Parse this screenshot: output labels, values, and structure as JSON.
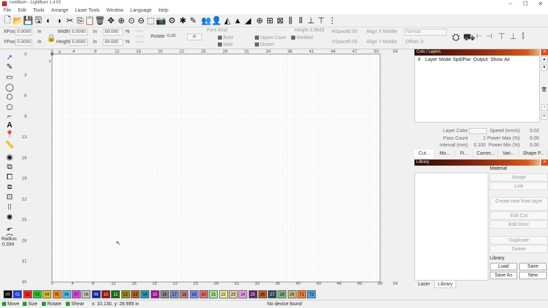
{
  "window": {
    "title": "<untitled> - LightBurn 1.4.03"
  },
  "menu": [
    "File",
    "Edit",
    "Tools",
    "Arrange",
    "Laser Tools",
    "Window",
    "Language",
    "Help"
  ],
  "props": {
    "xpos_label": "XPos",
    "xpos_value": "0.0000",
    "ypos_label": "YPos",
    "ypos_value": "0.0000",
    "unit_in": "in",
    "width_label": "Width",
    "width_value": "0.0000",
    "height_label": "Height",
    "height_value": "0.0000",
    "scale_w": "00.000",
    "scale_h": "00.000",
    "pct": "%",
    "rotate_label": "Rotate",
    "rotate_value": "0.00",
    "rotate_unit": "in",
    "font_label": "Font",
    "font_value": "Arial",
    "text_height_label": "Height",
    "text_height_value": "3.9843",
    "bold": "Bold",
    "italic": "Italic",
    "upper": "Upper Case",
    "welded": "Welded",
    "distort": "Distort",
    "hspace_label": "HSpace",
    "hspace_value": "0.00",
    "vspace_label": "VSpace",
    "vspace_value": "0.00",
    "align_x": "Align X Middle",
    "align_y": "Align Y Middle",
    "normal": "Normal",
    "offset_label": "Offset",
    "offset_value": "0"
  },
  "canvas": {
    "x_ticks": [
      "0",
      "4",
      "8",
      "12",
      "16",
      "19",
      "22",
      "25",
      "28",
      "31",
      "34",
      "38",
      "41",
      "44",
      "47",
      "50",
      "54"
    ],
    "bottom_ticks": [
      "0",
      "4",
      "8",
      "12",
      "16",
      "19",
      "22",
      "25",
      "28",
      "31",
      "33",
      "36",
      "40",
      "43",
      "46",
      "49",
      "50",
      "54"
    ],
    "y_ticks": [
      "0",
      "3",
      "6",
      "9",
      "13",
      "16",
      "19",
      "22",
      "25",
      "28",
      "31",
      "35"
    ],
    "x_marker": "X",
    "y_marker": "Y"
  },
  "tools": {
    "radius_label": "Radius:",
    "radius_value": "0.394"
  },
  "cuts": {
    "title": "Cuts / Layers",
    "headers": [
      "#",
      "Layer",
      "Mode",
      "Spd/Pwr",
      "Output",
      "Show",
      "Air"
    ],
    "layer_color": "Layer Color",
    "pass_count_label": "Pass Count",
    "pass_count_value": "1",
    "interval_label": "Interval (mm)",
    "interval_value": "0.100",
    "speed_label": "Speed (mm/s)",
    "speed_value": "0.02",
    "powermax_label": "Power Max (%)",
    "powermax_value": "0.00",
    "powermin_label": "Power Min (%)",
    "powermin_value": "0.00",
    "tabs": [
      "Cut...",
      "Mo...",
      "Fi...",
      "Camer...",
      "Vari...",
      "Shape P..."
    ]
  },
  "library": {
    "title": "Library",
    "material": "Material",
    "assign": "Assign",
    "link": "Link",
    "create_new": "Create new from layer",
    "edit_cut": "Edit Cut",
    "edit_desc": "Edit Desc",
    "duplicate": "Duplicate",
    "delete": "Delete",
    "library_label": "Library",
    "load": "Load",
    "save": "Save",
    "save_as": "Save As",
    "new": "New",
    "tab_laser": "Laser",
    "tab_library": "Library"
  },
  "palette": [
    {
      "label": "00",
      "color": "#000000",
      "text": "#ffffff"
    },
    {
      "label": "01",
      "color": "#1e3cff",
      "text": "#ffffff"
    },
    {
      "label": "02",
      "color": "#ff2222",
      "text": "#000000"
    },
    {
      "label": "03",
      "color": "#22cc22",
      "text": "#000000"
    },
    {
      "label": "04",
      "color": "#d6c21c",
      "text": "#000000"
    },
    {
      "label": "05",
      "color": "#ff8a1e",
      "text": "#000000"
    },
    {
      "label": "06",
      "color": "#3ec9e8",
      "text": "#000000"
    },
    {
      "label": "07",
      "color": "#e63ee6",
      "text": "#000000"
    },
    {
      "label": "08",
      "color": "#c8c8c8",
      "text": "#000000"
    },
    {
      "label": "09",
      "color": "#1028a0",
      "text": "#ffffff"
    },
    {
      "label": "10",
      "color": "#a01010",
      "text": "#ffffff"
    },
    {
      "label": "11",
      "color": "#107010",
      "text": "#ffffff"
    },
    {
      "label": "12",
      "color": "#9a8a10",
      "text": "#000000"
    },
    {
      "label": "13",
      "color": "#b0621a",
      "text": "#000000"
    },
    {
      "label": "14",
      "color": "#1a9ab8",
      "text": "#000000"
    },
    {
      "label": "15",
      "color": "#a010a0",
      "text": "#ffffff"
    },
    {
      "label": "16",
      "color": "#888888",
      "text": "#000000"
    },
    {
      "label": "17",
      "color": "#7a8ab8",
      "text": "#000000"
    },
    {
      "label": "18",
      "color": "#b87a8a",
      "text": "#000000"
    },
    {
      "label": "19",
      "color": "#6a8ae8",
      "text": "#000000"
    },
    {
      "label": "20",
      "color": "#e86a6a",
      "text": "#000000"
    },
    {
      "label": "21",
      "color": "#9ae89a",
      "text": "#000000"
    },
    {
      "label": "22",
      "color": "#e8e89a",
      "text": "#000000"
    },
    {
      "label": "23",
      "color": "#e8c8a0",
      "text": "#000000"
    },
    {
      "label": "24",
      "color": "#e8a0e8",
      "text": "#000000"
    },
    {
      "label": "25",
      "color": "#5a2a6a",
      "text": "#ffffff"
    },
    {
      "label": "26",
      "color": "#c0581a",
      "text": "#000000"
    },
    {
      "label": "27",
      "color": "#2a4a5a",
      "text": "#ffffff"
    },
    {
      "label": "28",
      "color": "#7ab87a",
      "text": "#000000"
    },
    {
      "label": "29",
      "color": "#c8b878",
      "text": "#000000"
    },
    {
      "label": "T1",
      "color": "#ff7a2a",
      "text": "#000000"
    },
    {
      "label": "T2",
      "color": "#4aa0e8",
      "text": "#000000"
    }
  ],
  "status": {
    "move": "Move",
    "size": "Size",
    "rotate": "Rotate",
    "shear": "Shear",
    "coords": "x: 10.130, y: 28.985 in",
    "device": "No device found"
  }
}
